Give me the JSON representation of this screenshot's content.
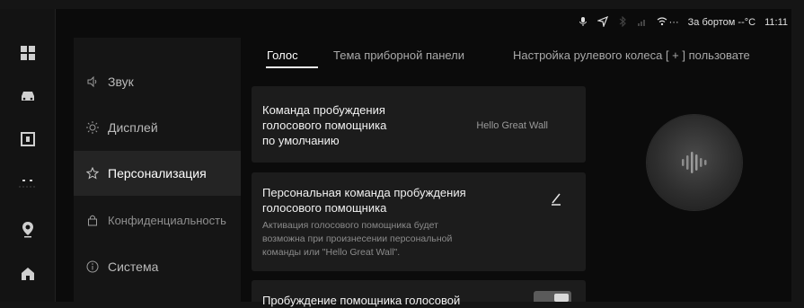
{
  "status_bar": {
    "onboard_label": "За бортом",
    "temperature": "--°C",
    "time": "11:11",
    "dots": "···"
  },
  "rail": {
    "icons": [
      "apps-icon",
      "car-icon",
      "media-icon",
      "divider-icon",
      "navigation-icon",
      "home-icon"
    ]
  },
  "menu": {
    "items": [
      {
        "label": "Звук",
        "icon": "sound-icon"
      },
      {
        "label": "Дисплей",
        "icon": "brightness-icon"
      },
      {
        "label": "Персонализация",
        "icon": "personalization-icon"
      },
      {
        "label": "Конфиденциальность",
        "icon": "lock-icon"
      },
      {
        "label": "Система",
        "icon": "info-icon"
      }
    ],
    "active": "Персонализация"
  },
  "tabs": {
    "items": [
      "Голос",
      "Тема приборной панели",
      "Настройка рулевого колеса [ + ] пользовате"
    ],
    "active": "Голос"
  },
  "cards": {
    "default_wake": {
      "title_line1": "Команда пробуждения",
      "title_line2": "голосового помощника",
      "title_line3": "по умолчанию",
      "value": "Hello Great Wall"
    },
    "custom_wake": {
      "title_line1": "Персональная команда пробуждения",
      "title_line2": "голосового помощника",
      "desc_line1": "Активация голосового помощника будет",
      "desc_line2": "возможна при произнесении персональной",
      "desc_line3": "команды или \"Hello Great Wall\"."
    },
    "voice_wake": {
      "title": "Пробуждение помощника голосовой",
      "toggle_on": true
    }
  },
  "voice_orb": {
    "icon": "voice-wave-icon"
  },
  "colors": {
    "background": "#0b0b0b",
    "panel": "#151515",
    "card": "#1c1c1c",
    "active_menu": "#242424",
    "text_primary": "#f2f2f2",
    "text_secondary": "#8b8b8b"
  }
}
